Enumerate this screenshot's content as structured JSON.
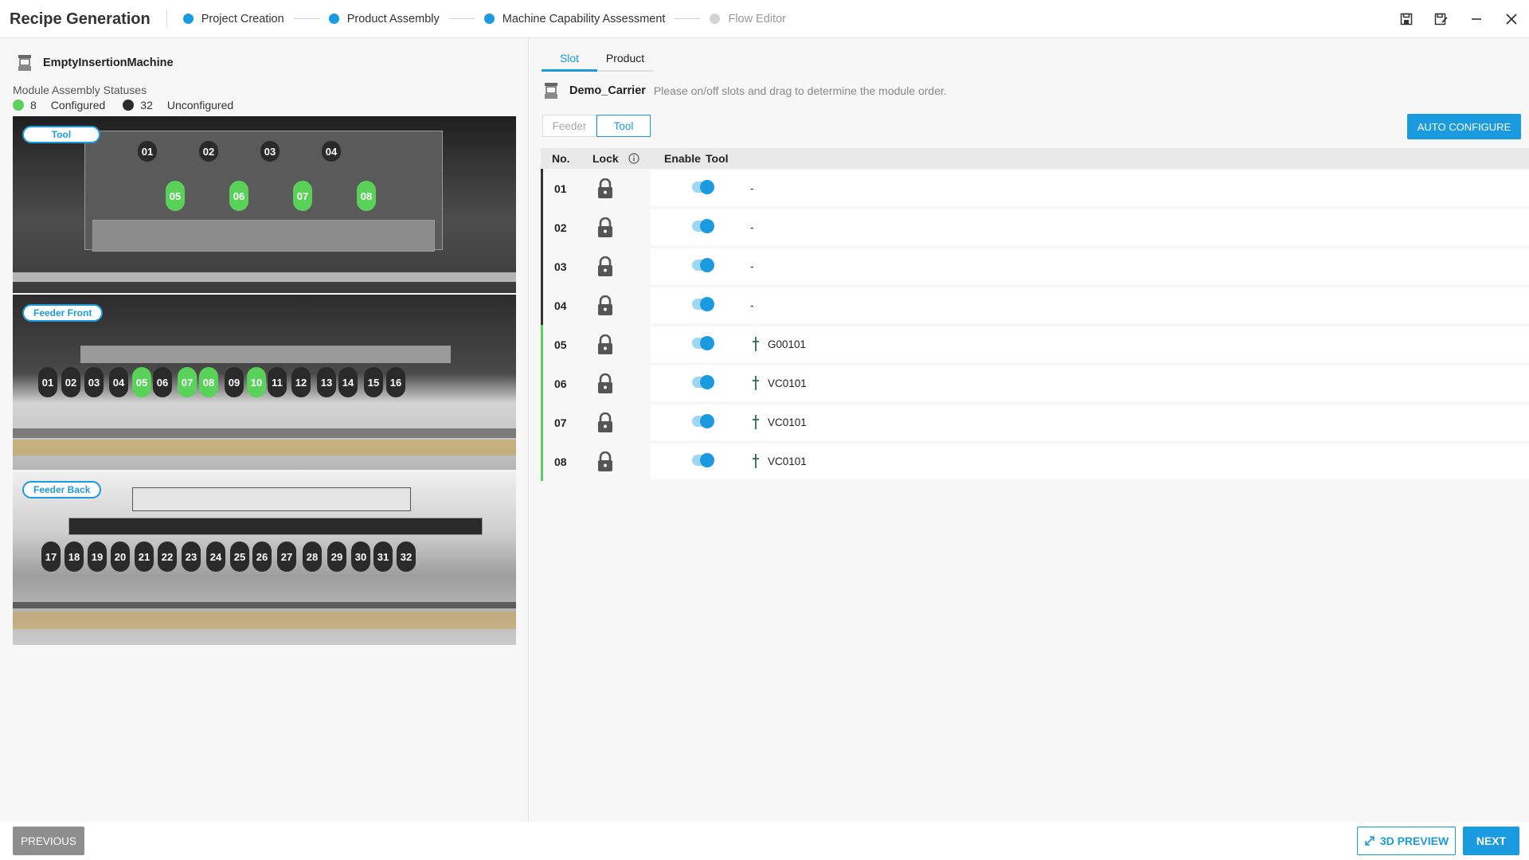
{
  "app": {
    "title": "Recipe Generation"
  },
  "steps": [
    {
      "label": "Project Creation",
      "state": "done"
    },
    {
      "label": "Product Assembly",
      "state": "done"
    },
    {
      "label": "Machine Capability Assessment",
      "state": "active"
    },
    {
      "label": "Flow Editor",
      "state": "inactive"
    }
  ],
  "colors": {
    "accent": "#1a9be0",
    "configured": "#5ad25a",
    "unconfigured": "#2a2a2a"
  },
  "left": {
    "machine_name": "EmptyInsertionMachine",
    "status_title": "Module Assembly Statuses",
    "configured_count": "8",
    "configured_label": "Configured",
    "unconfigured_count": "32",
    "unconfigured_label": "Unconfigured",
    "sections": {
      "tool": "Tool",
      "feeder_front": "Feeder Front",
      "feeder_back": "Feeder Back"
    },
    "tool_modules_top": [
      "01",
      "02",
      "03",
      "04"
    ],
    "tool_modules_bottom": [
      "05",
      "06",
      "07",
      "08"
    ],
    "feeder_front_modules": [
      "01",
      "02",
      "03",
      "04",
      "05",
      "06",
      "07",
      "08",
      "09",
      "10",
      "11",
      "12",
      "13",
      "14",
      "15",
      "16"
    ],
    "feeder_front_configured": [
      "05",
      "07",
      "08",
      "10"
    ],
    "feeder_back_modules": [
      "17",
      "18",
      "19",
      "20",
      "21",
      "22",
      "23",
      "24",
      "25",
      "26",
      "27",
      "28",
      "29",
      "30",
      "31",
      "32"
    ]
  },
  "right": {
    "tabs": [
      "Slot",
      "Product"
    ],
    "active_tab": "Slot",
    "carrier_name": "Demo_Carrier",
    "carrier_hint": "Please on/off slots and drag to determine the module order.",
    "type_buttons": [
      "Feeder",
      "Tool"
    ],
    "active_type": "Tool",
    "auto_configure": "AUTO CONFIGURE",
    "columns": {
      "no": "No.",
      "lock": "Lock",
      "enable": "Enable",
      "tool": "Tool"
    },
    "rows": [
      {
        "no": "01",
        "tool": "-",
        "configured": false,
        "enabled": true,
        "locked": true
      },
      {
        "no": "02",
        "tool": "-",
        "configured": false,
        "enabled": true,
        "locked": true
      },
      {
        "no": "03",
        "tool": "-",
        "configured": false,
        "enabled": true,
        "locked": true
      },
      {
        "no": "04",
        "tool": "-",
        "configured": false,
        "enabled": true,
        "locked": true
      },
      {
        "no": "05",
        "tool": "G00101",
        "configured": true,
        "enabled": true,
        "locked": true
      },
      {
        "no": "06",
        "tool": "VC0101",
        "configured": true,
        "enabled": true,
        "locked": true
      },
      {
        "no": "07",
        "tool": "VC0101",
        "configured": true,
        "enabled": true,
        "locked": true
      },
      {
        "no": "08",
        "tool": "VC0101",
        "configured": true,
        "enabled": true,
        "locked": true
      }
    ]
  },
  "footer": {
    "previous": "PREVIOUS",
    "preview_3d": "3D PREVIEW",
    "next": "NEXT"
  }
}
